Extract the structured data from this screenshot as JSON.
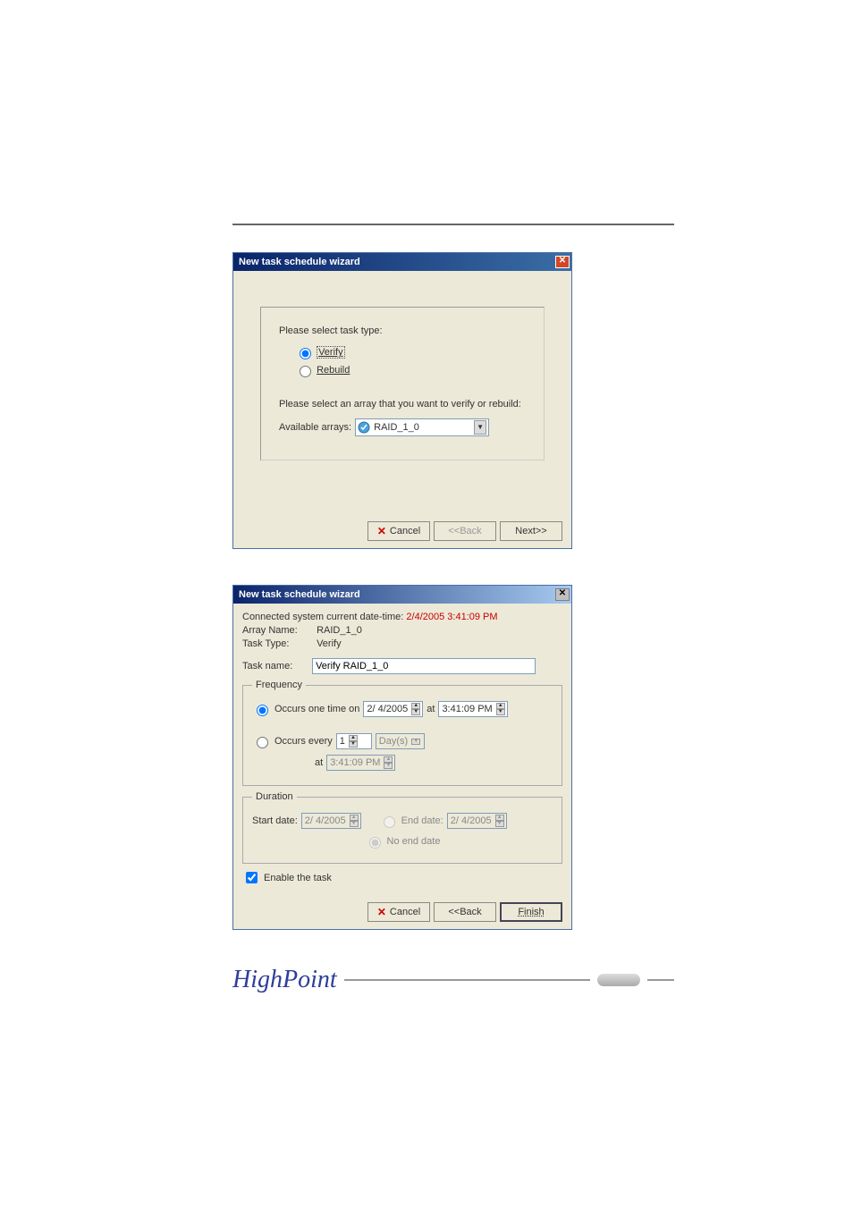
{
  "dialog1": {
    "title": "New task schedule wizard",
    "prompt1": "Please select task type:",
    "radio_verify": "Verify",
    "radio_rebuild": "Rebuild",
    "prompt2": "Please select an array that you want to verify or rebuild:",
    "available_label": "Available arrays:",
    "selected_array": "RAID_1_0",
    "btn_cancel": "Cancel",
    "btn_back": "<<Back",
    "btn_next": "Next>>"
  },
  "dialog2": {
    "title": "New task schedule wizard",
    "connected_label": "Connected system current date-time:",
    "connected_value": "2/4/2005 3:41:09 PM",
    "array_name_label": "Array Name:",
    "array_name_value": "RAID_1_0",
    "task_type_label": "Task Type:",
    "task_type_value": "Verify",
    "task_name_label": "Task name:",
    "task_name_value": "Verify RAID_1_0",
    "freq_legend": "Frequency",
    "occurs_one_label": "Occurs one time on",
    "occurs_one_date": "2/ 4/2005",
    "at_label": "at",
    "occurs_one_time": "3:41:09 PM",
    "occurs_every_label": "Occurs every",
    "occurs_every_value": "1",
    "occurs_every_unit": "Day(s)",
    "occurs_every_time": "3:41:09 PM",
    "duration_legend": "Duration",
    "start_date_label": "Start date:",
    "start_date_value": "2/ 4/2005",
    "end_date_label": "End date:",
    "end_date_value": "2/ 4/2005",
    "no_end_label": "No end date",
    "enable_label": "Enable the task",
    "btn_cancel": "Cancel",
    "btn_back": "<<Back",
    "btn_finish": "Finish"
  },
  "footer_brand": "HighPoint"
}
